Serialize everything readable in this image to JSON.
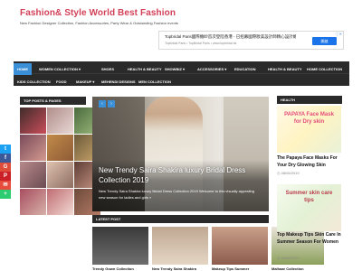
{
  "site": {
    "title": "Fashion& Style World Best Fashion",
    "description": "New Fashion Designer Collection, Fashion Accessories, Party Wear & Outstanding Fashion events"
  },
  "ad": {
    "title": "Topbridal Paris國際婚紗首次登陸香港 - 已招募國際歐美設計師精心設計婚紗系列",
    "url": "Topbridal Paris • TopBridal Paris • www.topbridal.hk",
    "button": "開啟",
    "info_icon": "info-icon"
  },
  "nav": {
    "items": [
      {
        "label": "HOME",
        "active": true
      },
      {
        "label": "WOMEN COLLECTION",
        "dropdown": true
      },
      {
        "label": "SHOES"
      },
      {
        "label": "HEALTH & BEAUTY"
      },
      {
        "label": "SHOWBIZ",
        "dropdown": true
      },
      {
        "label": "ACCESSORIES",
        "dropdown": true
      },
      {
        "label": "EDUCATION"
      },
      {
        "label": "HEALTH & BEAUTY"
      },
      {
        "label": "HOME COLLECTION"
      },
      {
        "label": "KIDS COLLECTION"
      },
      {
        "label": "FOOD"
      },
      {
        "label": "MAKEUP",
        "dropdown": true
      },
      {
        "label": "MEHENDI DESIGNS"
      },
      {
        "label": "MEN COLLECTION"
      }
    ]
  },
  "social": [
    {
      "icon": "twitter-icon",
      "color": "#1da1f2",
      "glyph": "t"
    },
    {
      "icon": "facebook-icon",
      "color": "#3b5998",
      "glyph": "f"
    },
    {
      "icon": "google-plus-icon",
      "color": "#dd4b39",
      "glyph": "G"
    },
    {
      "icon": "pinterest-icon",
      "color": "#cb2027",
      "glyph": "P"
    },
    {
      "icon": "email-icon",
      "color": "#e74c3c",
      "glyph": "✉"
    },
    {
      "icon": "share-icon",
      "color": "#2ecc71",
      "glyph": "+"
    }
  ],
  "sidebar": {
    "heading": "TOP POSTS & PAGES"
  },
  "slider": {
    "title": "New Trendy Saira Shakira luxury Bridal Dress Collection 2019",
    "excerpt": "New Trendy Saira Shakira luxury Bridal Dress Collection 2019 Welcome to this visually appealing new season for ladies and girls »",
    "prev_icon": "chevron-left-icon",
    "next_icon": "chevron-right-icon"
  },
  "latest": {
    "heading": "LATEST POST",
    "cards": [
      {
        "title": "Trendy Gown Collection"
      },
      {
        "title": "New Trendy Saira Shakira"
      },
      {
        "title": "Makeup Tips Summer"
      },
      {
        "title": "Malhaar Collection"
      }
    ]
  },
  "health": {
    "heading": "HEALTH",
    "posts": [
      {
        "title": "The Papaya Face Masks For Your Dry Glowing Skin",
        "date": "08/06/2019",
        "image_text": "PAPAYA Face Mask for Dry skin"
      },
      {
        "title": "Top Makeup Tips Skin Care In Summer Season For Women",
        "date": "08/06/2019",
        "image_text": "Summer skin care tips"
      }
    ]
  },
  "colors": {
    "accent": "#3b8fd6",
    "brand": "#d23f57",
    "nav_bg": "#2a2a2a"
  }
}
